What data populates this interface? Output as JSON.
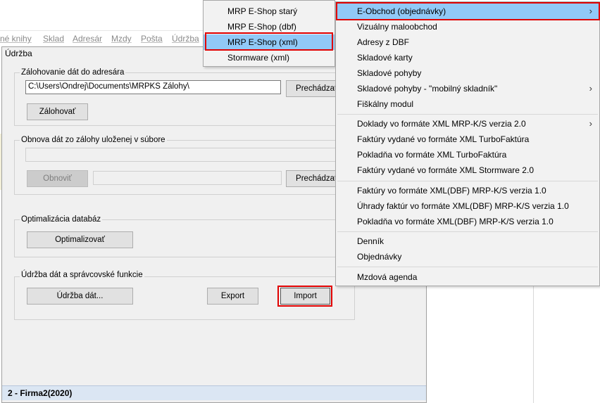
{
  "background_menu": {
    "items": [
      "né knihy",
      "Sklad",
      "Adresár",
      "Mzdy",
      "Pošta",
      "Údržba"
    ]
  },
  "dialog": {
    "title": "Údržba",
    "backup_group": {
      "label": "Zálohovanie dát do adresára",
      "path_value": "C:\\Users\\Ondrej\\Documents\\MRPKS Zálohy\\",
      "browse_label": "Prechádzať...",
      "backup_button": "Zálohovať"
    },
    "restore_group": {
      "label": "Obnova dát zo zálohy uloženej v súbore",
      "path_value": "",
      "restore_button": "Obnoviť",
      "file_value": "",
      "browse_label": "Prechádzať..."
    },
    "optimize_group": {
      "label": "Optimalizácia databáz",
      "optimize_button": "Optimalizovať"
    },
    "maintenance_group": {
      "label": "Údržba dát a správcovské funkcie",
      "maintenance_button": "Údržba dát...",
      "export_button": "Export",
      "import_button": "Import"
    },
    "status": "2 - Firma2(2020)"
  },
  "submenu": {
    "items": [
      {
        "label": "MRP E-Shop starý"
      },
      {
        "label": "MRP E-Shop (dbf)"
      },
      {
        "label": "MRP E-Shop (xml)",
        "selected": true
      },
      {
        "label": "Stormware (xml)"
      }
    ]
  },
  "menu": {
    "items": [
      {
        "label": "E-Obchod (objednávky)",
        "has_submenu": true,
        "selected": true
      },
      {
        "label": "Vizuálny maloobchod"
      },
      {
        "label": "Adresy z DBF"
      },
      {
        "label": "Skladové karty"
      },
      {
        "label": "Skladové pohyby"
      },
      {
        "label": "Skladové pohyby - \"mobilný skladník\"",
        "has_submenu": true
      },
      {
        "label": "Fiškálny modul"
      },
      {
        "label": "Doklady vo formáte XML MRP-K/S verzia 2.0",
        "has_submenu": true
      },
      {
        "label": "Faktúry vydané vo formáte XML TurboFaktúra"
      },
      {
        "label": "Pokladňa vo formáte XML TurboFaktúra"
      },
      {
        "label": "Faktúry vydané vo formáte XML Stormware 2.0"
      },
      {
        "label": "Faktúry vo formáte XML(DBF) MRP-K/S verzia 1.0"
      },
      {
        "label": "Úhrady faktúr vo formáte XML(DBF) MRP-K/S verzia 1.0"
      },
      {
        "label": "Pokladňa vo formáte XML(DBF) MRP-K/S verzia 1.0"
      },
      {
        "label": "Denník"
      },
      {
        "label": "Objednávky"
      },
      {
        "label": "Mzdová agenda"
      }
    ],
    "arrow_glyph": "›"
  },
  "colors": {
    "highlight": "#e00000",
    "selection": "#91c9f7",
    "status_bar": "#dbe6f3"
  }
}
